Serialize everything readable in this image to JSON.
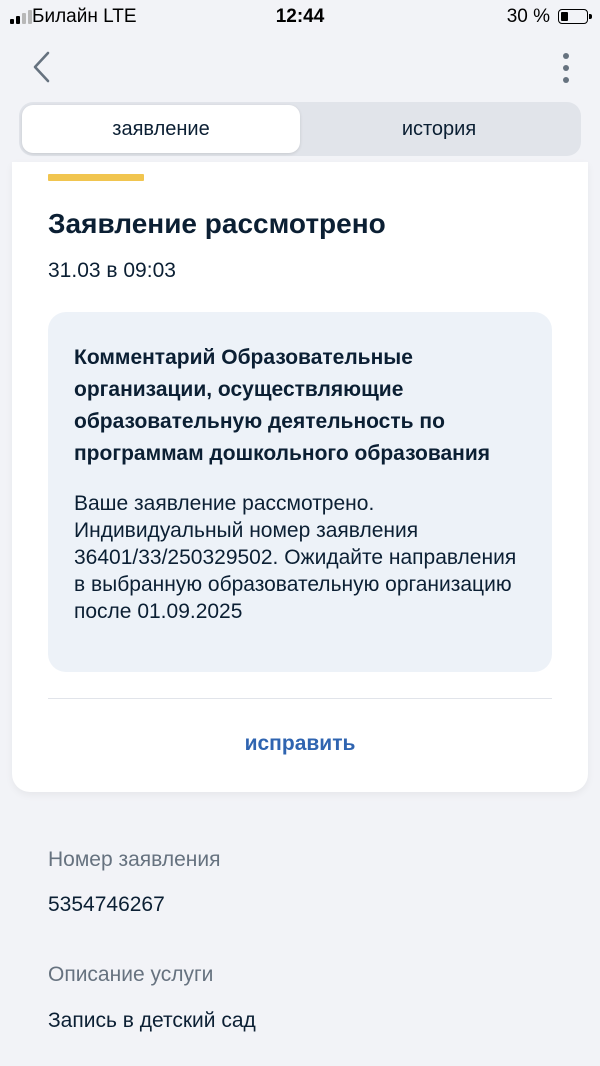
{
  "status_bar": {
    "carrier": "Билайн  LTE",
    "time": "12:44",
    "battery_percent": "30 %",
    "battery_level": 0.3,
    "signal_bars_on": 2,
    "signal_bars_total": 4
  },
  "nav": {
    "back_icon": "chevron-left-icon",
    "menu_icon": "more-vertical-icon"
  },
  "tabs": [
    {
      "label": "заявление",
      "active": true
    },
    {
      "label": "история",
      "active": false
    }
  ],
  "status": {
    "title": "Заявление рассмотрено",
    "date": "31.03 в 09:03",
    "accent_color": "#f1c54f"
  },
  "comment": {
    "title": "Комментарий Образовательные организации, осуществляющие образовательную деятельность по программам дошкольного образования",
    "text": "Ваше заявление рассмотрено. Индивидуальный номер заявления 36401/33/250329502. Ожидайте направления в выбранную образовательную организацию после 01.09.2025"
  },
  "actions": {
    "edit_label": "исправить",
    "link_color": "#2f64b0"
  },
  "details": {
    "number_label": "Номер заявления",
    "number_value": "5354746267",
    "service_label": "Описание услуги",
    "service_value": "Запись в детский сад"
  }
}
